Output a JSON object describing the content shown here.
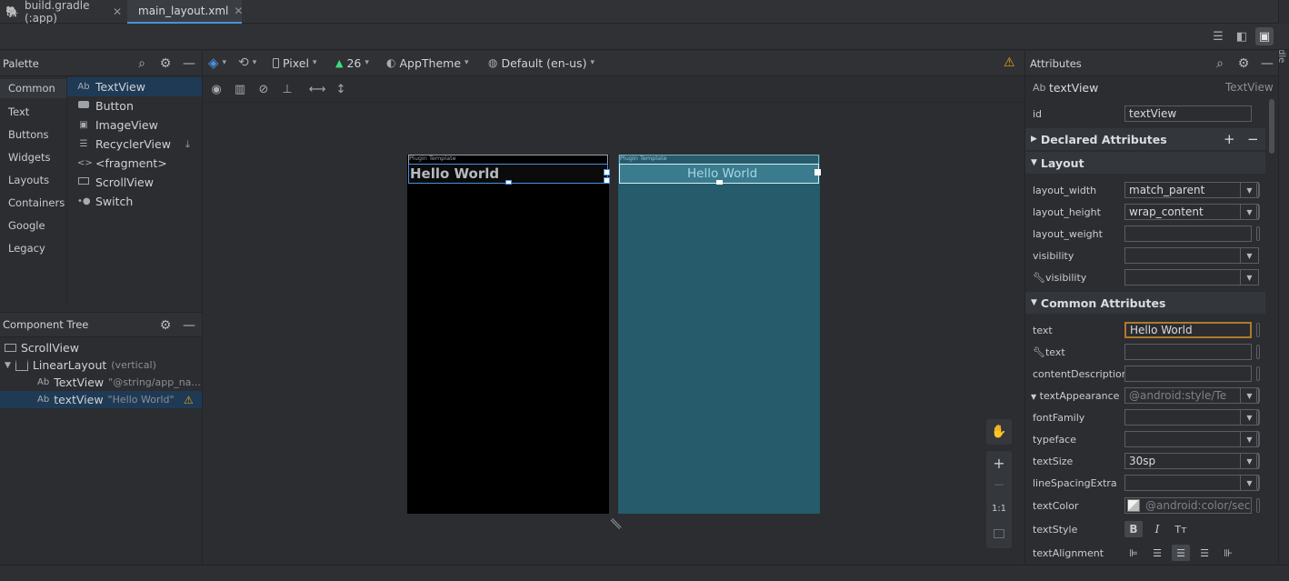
{
  "tabs": [
    {
      "label": "build.gradle (:app)",
      "close": "✕",
      "icon": "gradle-elephant-icon"
    },
    {
      "label": "main_layout.xml",
      "close": "✕",
      "icon": "layout-xml-icon",
      "active": true
    }
  ],
  "gradle_side_label": "Gradle",
  "palette": {
    "title": "Palette",
    "categories": [
      "Common",
      "Text",
      "Buttons",
      "Widgets",
      "Layouts",
      "Containers",
      "Google",
      "Legacy"
    ],
    "items": [
      {
        "icon": "Ab",
        "label": "TextView"
      },
      {
        "icon": "button-icon",
        "label": "Button"
      },
      {
        "icon": "image-icon",
        "label": "ImageView"
      },
      {
        "icon": "list-icon",
        "label": "RecyclerView"
      },
      {
        "icon": "<>",
        "label": "<fragment>"
      },
      {
        "icon": "scrollview-icon",
        "label": "ScrollView"
      },
      {
        "icon": "switch-icon",
        "label": "Switch"
      }
    ]
  },
  "component_tree": {
    "title": "Component Tree",
    "nodes": [
      {
        "label": "ScrollView",
        "sub": ""
      },
      {
        "label": "LinearLayout",
        "sub": "(vertical)"
      },
      {
        "icon": "Ab",
        "label": "TextView",
        "sub": "\"@string/app_na..."
      },
      {
        "icon": "Ab",
        "label": "textView",
        "sub": "\"Hello World\""
      }
    ]
  },
  "toolbar": {
    "device": "Pixel",
    "api": "26",
    "theme": "AppTheme",
    "locale": "Default (en-us)"
  },
  "preview": {
    "template_label": "Plugin Template",
    "hello": "Hello World"
  },
  "zoom": {
    "plus": "+",
    "minus": "—",
    "one_to_one": "1:1"
  },
  "attributes": {
    "title": "Attributes",
    "component_name": "textView",
    "component_type": "TextView",
    "component_icon": "Ab",
    "id_label": "id",
    "id_value": "textView",
    "declared_section": "Declared Attributes",
    "layout_section": "Layout",
    "common_section": "Common Attributes",
    "layout_rows": [
      {
        "label": "layout_width",
        "value": "match_parent",
        "dropdown": true
      },
      {
        "label": "layout_height",
        "value": "wrap_content",
        "dropdown": true
      },
      {
        "label": "layout_weight",
        "value": "",
        "dropdown": false
      },
      {
        "label": "visibility",
        "value": "",
        "dropdown": true
      },
      {
        "label": "visibility",
        "value": "",
        "dropdown": true,
        "tool": true
      }
    ],
    "common_rows": [
      {
        "label": "text",
        "value": "Hello World",
        "dropdown": false,
        "focused": true
      },
      {
        "label": "text",
        "value": "",
        "dropdown": false,
        "tool": true
      },
      {
        "label": "contentDescription",
        "value": "",
        "dropdown": false
      },
      {
        "label": "textAppearance",
        "value": "@android:style/Te",
        "dropdown": true,
        "expanded": true,
        "placeholder": true
      },
      {
        "label": "fontFamily",
        "value": "",
        "dropdown": true
      },
      {
        "label": "typeface",
        "value": "",
        "dropdown": true
      },
      {
        "label": "textSize",
        "value": "30sp",
        "dropdown": true
      },
      {
        "label": "lineSpacingExtra",
        "value": "",
        "dropdown": true
      },
      {
        "label": "textColor",
        "value": "@android:color/seco",
        "dropdown": false,
        "swatch": true,
        "placeholder": true
      }
    ],
    "text_style_label": "textStyle",
    "text_style_buttons": [
      "B",
      "I",
      "Tт"
    ],
    "text_alignment_label": "textAlignment"
  },
  "colors": {
    "accent_blue": "#4c8fdd",
    "warning": "#e5a50a",
    "blueprint_bg": "#255b6b",
    "design_bg": "#000000"
  }
}
